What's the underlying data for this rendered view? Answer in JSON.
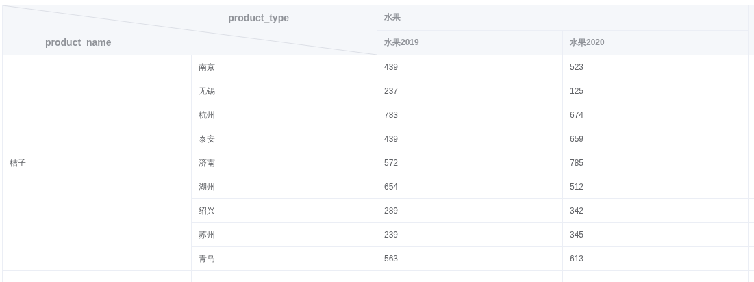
{
  "header": {
    "corner": {
      "column_label": "product_type",
      "row_label": "product_name"
    },
    "group": "水果",
    "columns": [
      "水果2019",
      "水果2020"
    ]
  },
  "groups": [
    {
      "name": "桔子",
      "rows": [
        {
          "city": "南京",
          "values": [
            "439",
            "523"
          ]
        },
        {
          "city": "无锡",
          "values": [
            "237",
            "125"
          ]
        },
        {
          "city": "杭州",
          "values": [
            "783",
            "674"
          ]
        },
        {
          "city": "泰安",
          "values": [
            "439",
            "659"
          ]
        },
        {
          "city": "济南",
          "values": [
            "572",
            "785"
          ]
        },
        {
          "city": "湖州",
          "values": [
            "654",
            "512"
          ]
        },
        {
          "city": "绍兴",
          "values": [
            "289",
            "342"
          ]
        },
        {
          "city": "苏州",
          "values": [
            "239",
            "345"
          ]
        },
        {
          "city": "青岛",
          "values": [
            "563",
            "613"
          ]
        }
      ]
    }
  ]
}
